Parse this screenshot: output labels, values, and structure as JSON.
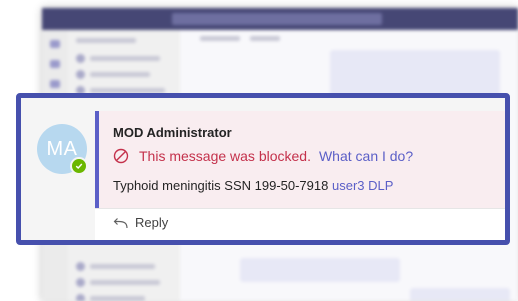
{
  "message": {
    "avatar_initials": "MA",
    "sender": "MOD Administrator",
    "blocked_text": "This message was blocked.",
    "help_link": "What can I do?",
    "body_text": "Typhoid meningitis SSN 199-50-7918",
    "mention": "user3 DLP",
    "reply_label": "Reply"
  },
  "colors": {
    "callout_border": "#4650ad",
    "blocked_red": "#c4314b",
    "link_purple": "#5b5fc7",
    "avatar_bg": "#b7d8ef",
    "presence_green": "#6bb700",
    "message_bg": "#f9edf0"
  },
  "icons": {
    "blocked": "prohibited-icon",
    "reply": "reply-arrow-icon",
    "presence": "available-check-icon"
  }
}
